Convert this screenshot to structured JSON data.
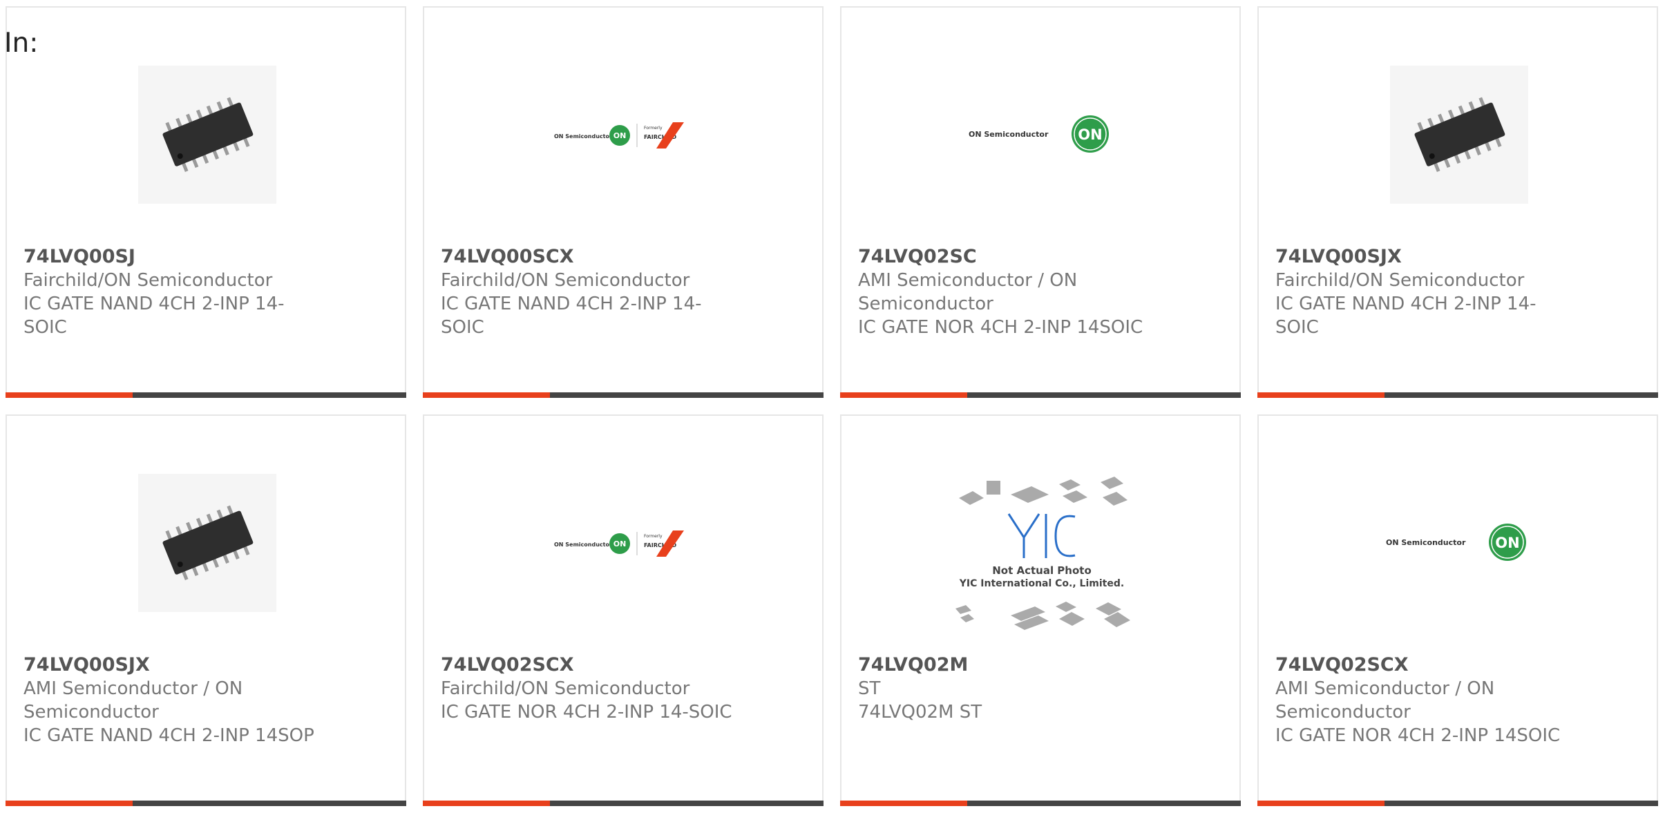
{
  "page": {
    "in_label": "In:"
  },
  "colors": {
    "accent": "#e8401c",
    "bar_dark": "#444444",
    "text": "#777777"
  },
  "products": [
    {
      "part": "74LVQ00SJ",
      "maker": "Fairchild/ON Semiconductor",
      "desc": "IC GATE NAND 4CH 2-INP 14-SOIC",
      "image": "chip-icon"
    },
    {
      "part": "74LVQ00SCX",
      "maker": "Fairchild/ON Semiconductor",
      "desc": "IC GATE NAND 4CH 2-INP 14-SOIC",
      "image": "on-fairchild-logo",
      "logo": {
        "brand": "ON Semiconductor",
        "mark": "ON",
        "formerly": "Formerly",
        "fairchild": "FAIRCHILD"
      }
    },
    {
      "part": "74LVQ02SC",
      "maker": "AMI Semiconductor / ON Semiconductor",
      "desc": "IC GATE NOR 4CH 2-INP 14SOIC",
      "image": "on-semi-logo",
      "logo": {
        "brand": "ON Semiconductor",
        "mark": "ON"
      }
    },
    {
      "part": "74LVQ00SJX",
      "maker": "Fairchild/ON Semiconductor",
      "desc": "IC GATE NAND 4CH 2-INP 14-SOIC",
      "image": "chip-icon"
    },
    {
      "part": "74LVQ00SJX",
      "maker": "AMI Semiconductor / ON Semiconductor",
      "desc": "IC GATE NAND 4CH 2-INP 14SOP",
      "image": "chip-icon"
    },
    {
      "part": "74LVQ02SCX",
      "maker": "Fairchild/ON Semiconductor",
      "desc": "IC GATE NOR 4CH 2-INP 14-SOIC",
      "image": "on-fairchild-logo",
      "logo": {
        "brand": "ON Semiconductor",
        "mark": "ON",
        "formerly": "Formerly",
        "fairchild": "FAIRCHILD"
      }
    },
    {
      "part": "74LVQ02M",
      "maker": "ST",
      "desc": "74LVQ02M ST",
      "image": "not-actual-photo",
      "placeholder": {
        "line1": "Not Actual Photo",
        "line2": "YIC International Co., Limited."
      }
    },
    {
      "part": "74LVQ02SCX",
      "maker": "AMI Semiconductor / ON Semiconductor",
      "desc": "IC GATE NOR 4CH 2-INP 14SOIC",
      "image": "on-semi-logo",
      "logo": {
        "brand": "ON Semiconductor",
        "mark": "ON"
      }
    }
  ]
}
